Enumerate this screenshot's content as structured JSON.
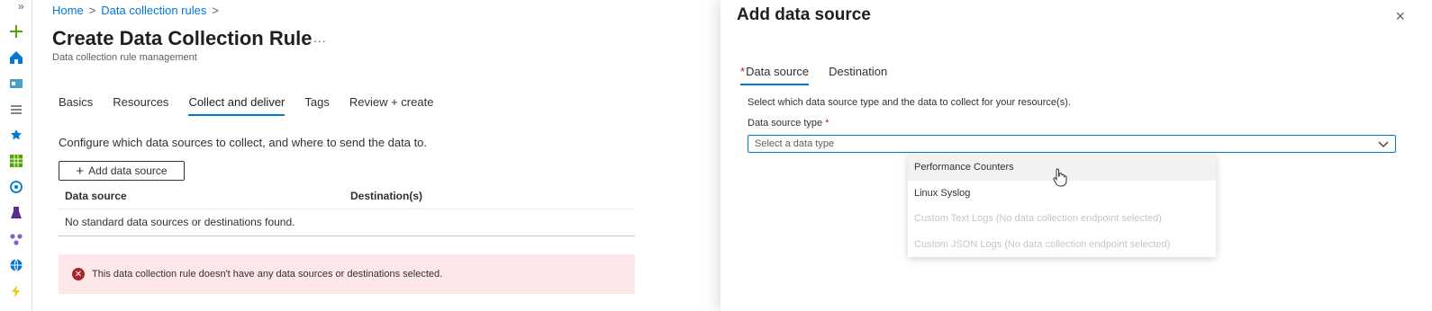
{
  "rail": {
    "expand_glyph": "»",
    "icons": [
      "plus-icon",
      "home-icon",
      "dashboard-icon",
      "list-icon",
      "favorite-star-icon",
      "grid-icon",
      "monitor-icon",
      "flask-icon",
      "cluster-icon",
      "globe-icon",
      "function-icon"
    ]
  },
  "breadcrumb": {
    "home": "Home",
    "sep": ">",
    "dcr": "Data collection rules"
  },
  "page": {
    "title": "Create Data Collection Rule",
    "more": "...",
    "subtitle": "Data collection rule management"
  },
  "tabs": [
    {
      "label": "Basics",
      "active": false
    },
    {
      "label": "Resources",
      "active": false
    },
    {
      "label": "Collect and deliver",
      "active": true
    },
    {
      "label": "Tags",
      "active": false
    },
    {
      "label": "Review + create",
      "active": false
    }
  ],
  "collect": {
    "description": "Configure which data sources to collect, and where to send the data to.",
    "add_button": "Add data source",
    "col_source": "Data source",
    "col_dest": "Destination(s)",
    "empty_text": "No standard data sources or destinations found.",
    "error_text": "This data collection rule doesn't have any data sources or destinations selected."
  },
  "panel": {
    "title": "Add data source",
    "close": "×",
    "tab_source": "Data source",
    "tab_destination": "Destination",
    "required_mark": "*",
    "description": "Select which data source type and the data to collect for your resource(s).",
    "field_label": "Data source type",
    "placeholder": "Select a data type",
    "options": [
      {
        "label": "Performance Counters",
        "state": "hover"
      },
      {
        "label": "Linux Syslog",
        "state": "enabled"
      },
      {
        "label": "Custom Text Logs (No data collection endpoint selected)",
        "state": "disabled"
      },
      {
        "label": "Custom JSON Logs (No data collection endpoint selected)",
        "state": "disabled"
      }
    ]
  },
  "colors": {
    "accent": "#0078d4",
    "error_bg": "#fde7e9",
    "error_icon": "#a4262c"
  }
}
